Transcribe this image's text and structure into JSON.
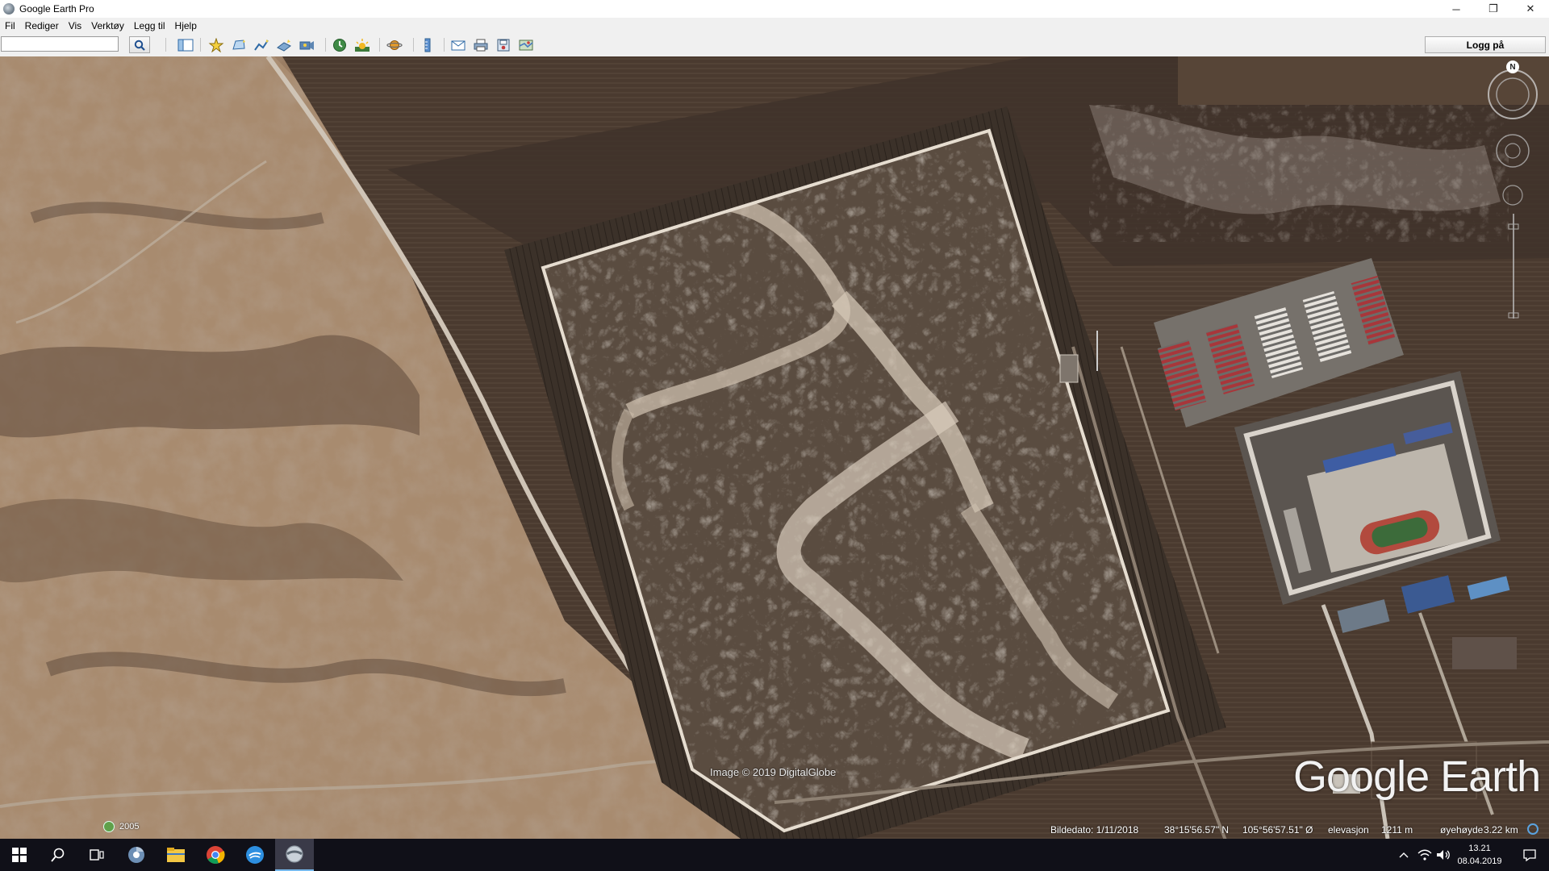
{
  "window": {
    "title": "Google Earth Pro",
    "minimize_glyph": "─",
    "restore_glyph": "❐",
    "close_glyph": "✕"
  },
  "menu": [
    "Fil",
    "Rediger",
    "Vis",
    "Verktøy",
    "Legg til",
    "Hjelp"
  ],
  "toolbar": {
    "search_value": "",
    "login_label": "Logg på",
    "icons": [
      "sidebar-icon",
      "placemark-icon",
      "polygon-icon",
      "path-icon",
      "image-overlay-icon",
      "tour-icon",
      "historical-imagery-icon",
      "sunlight-icon",
      "planets-icon",
      "ruler-icon",
      "email-icon",
      "print-icon",
      "save-image-icon",
      "maps-icon"
    ]
  },
  "map": {
    "attribution": "Image © 2019 DigitalGlobe",
    "logo": "Google Earth",
    "north_label": "N",
    "historical_year": "2005"
  },
  "status": {
    "image_date": "Bildedato: 1/11/2018",
    "latitude": "38°15'56.57\" N",
    "longitude": "105°56'57.51\" Ø",
    "elevation_label": "elevasjon",
    "elevation_value": "1211 m",
    "eye_altitude_label": "øyehøyde",
    "eye_altitude_value": "3.22 km"
  },
  "taskbar": {
    "time": "13.21",
    "date": "08.04.2019",
    "apps": [
      "start-icon",
      "search-icon",
      "task-view-icon",
      "chrome-alt-icon",
      "file-explorer-icon",
      "chrome-icon",
      "feedback-icon",
      "google-earth-icon"
    ]
  },
  "colors": {
    "desert": "#a88b6f",
    "dark_field": "#3a2f27",
    "enclosure": "#5a4c40",
    "wall": "#e6ddd0",
    "roof_red": "#a8363a",
    "track_green": "#3c6b3a"
  }
}
